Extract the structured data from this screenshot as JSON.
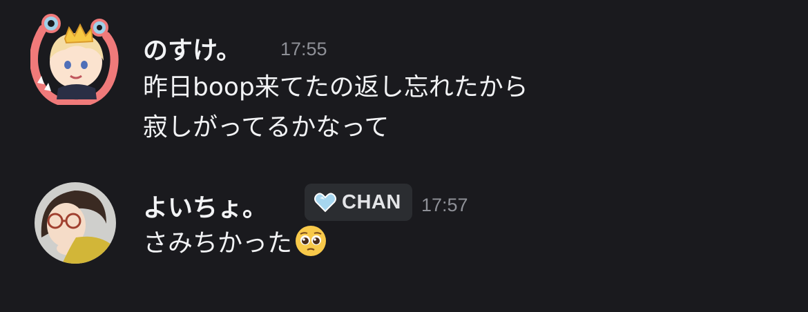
{
  "messages": [
    {
      "author": "のすけ。",
      "time": "17:55",
      "lines": [
        "昨日boop来てたの返し忘れたから",
        "寂しがってるかなって"
      ],
      "avatar_icon": "avatar-crown-character-icon"
    },
    {
      "author": "よいちょ。",
      "time": "17:57",
      "tag": {
        "label": "CHAN",
        "icon": "diamond-heart-icon"
      },
      "lines": [
        "さみちかった"
      ],
      "emoji": "pleading-face-icon",
      "avatar_icon": "avatar-glasses-character-icon"
    }
  ],
  "colors": {
    "background": "#1a1a1e",
    "text": "#f2f3f5",
    "timestamp": "#8e9097",
    "tag_bg": "#2b2d31"
  }
}
